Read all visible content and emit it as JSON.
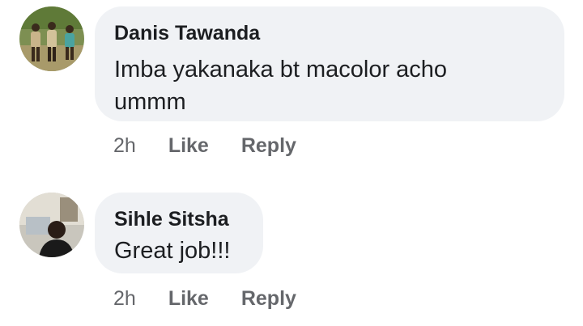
{
  "comments": [
    {
      "author": "Danis Tawanda",
      "text": "Imba yakanaka bt macolor acho ummm",
      "time": "2h",
      "like_label": "Like",
      "reply_label": "Reply"
    },
    {
      "author": "Sihle Sitsha",
      "text": "Great job!!!",
      "time": "2h",
      "like_label": "Like",
      "reply_label": "Reply"
    }
  ],
  "colors": {
    "bubble": "#f0f2f5",
    "text": "#1c1e21",
    "meta": "#65676b"
  }
}
